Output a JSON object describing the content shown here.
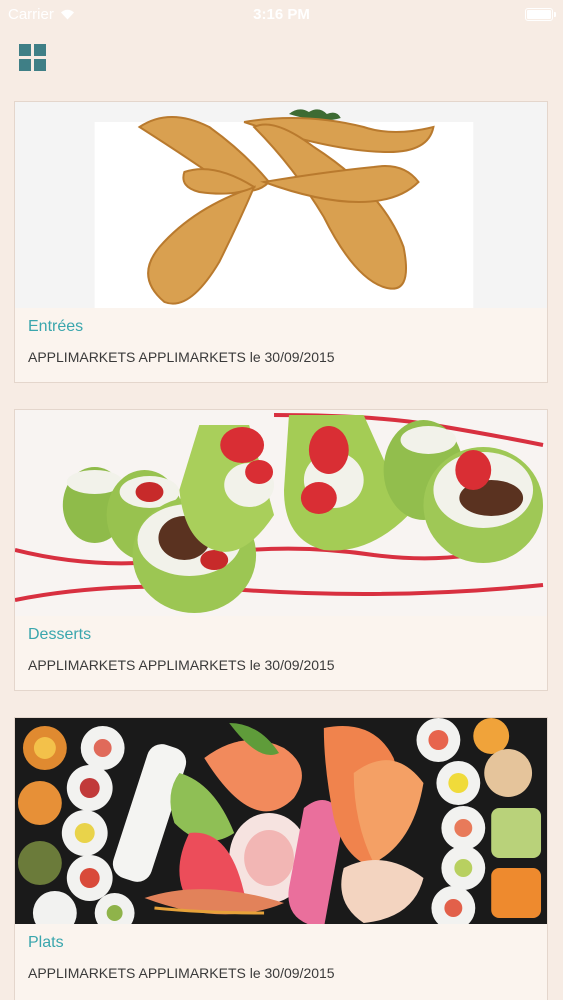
{
  "status_bar": {
    "carrier": "Carrier",
    "time": "3:16 PM",
    "battery_level": 1.0
  },
  "toolbar": {
    "menu_icon": "grid-menu-icon"
  },
  "cards": [
    {
      "title": "Entrées",
      "meta": "APPLIMARKETS APPLIMARKETS le 30/09/2015",
      "image": "tempura-shrimp-image"
    },
    {
      "title": "Desserts",
      "meta": "APPLIMARKETS APPLIMARKETS le 30/09/2015",
      "image": "strawberry-dessert-rolls-image"
    },
    {
      "title": "Plats",
      "meta": "APPLIMARKETS APPLIMARKETS le 30/09/2015",
      "image": "sushi-sashimi-platter-image"
    }
  ],
  "colors": {
    "background": "#f7ece4",
    "accent": "#3aa6ad",
    "menu_icon": "#3f7f86"
  }
}
